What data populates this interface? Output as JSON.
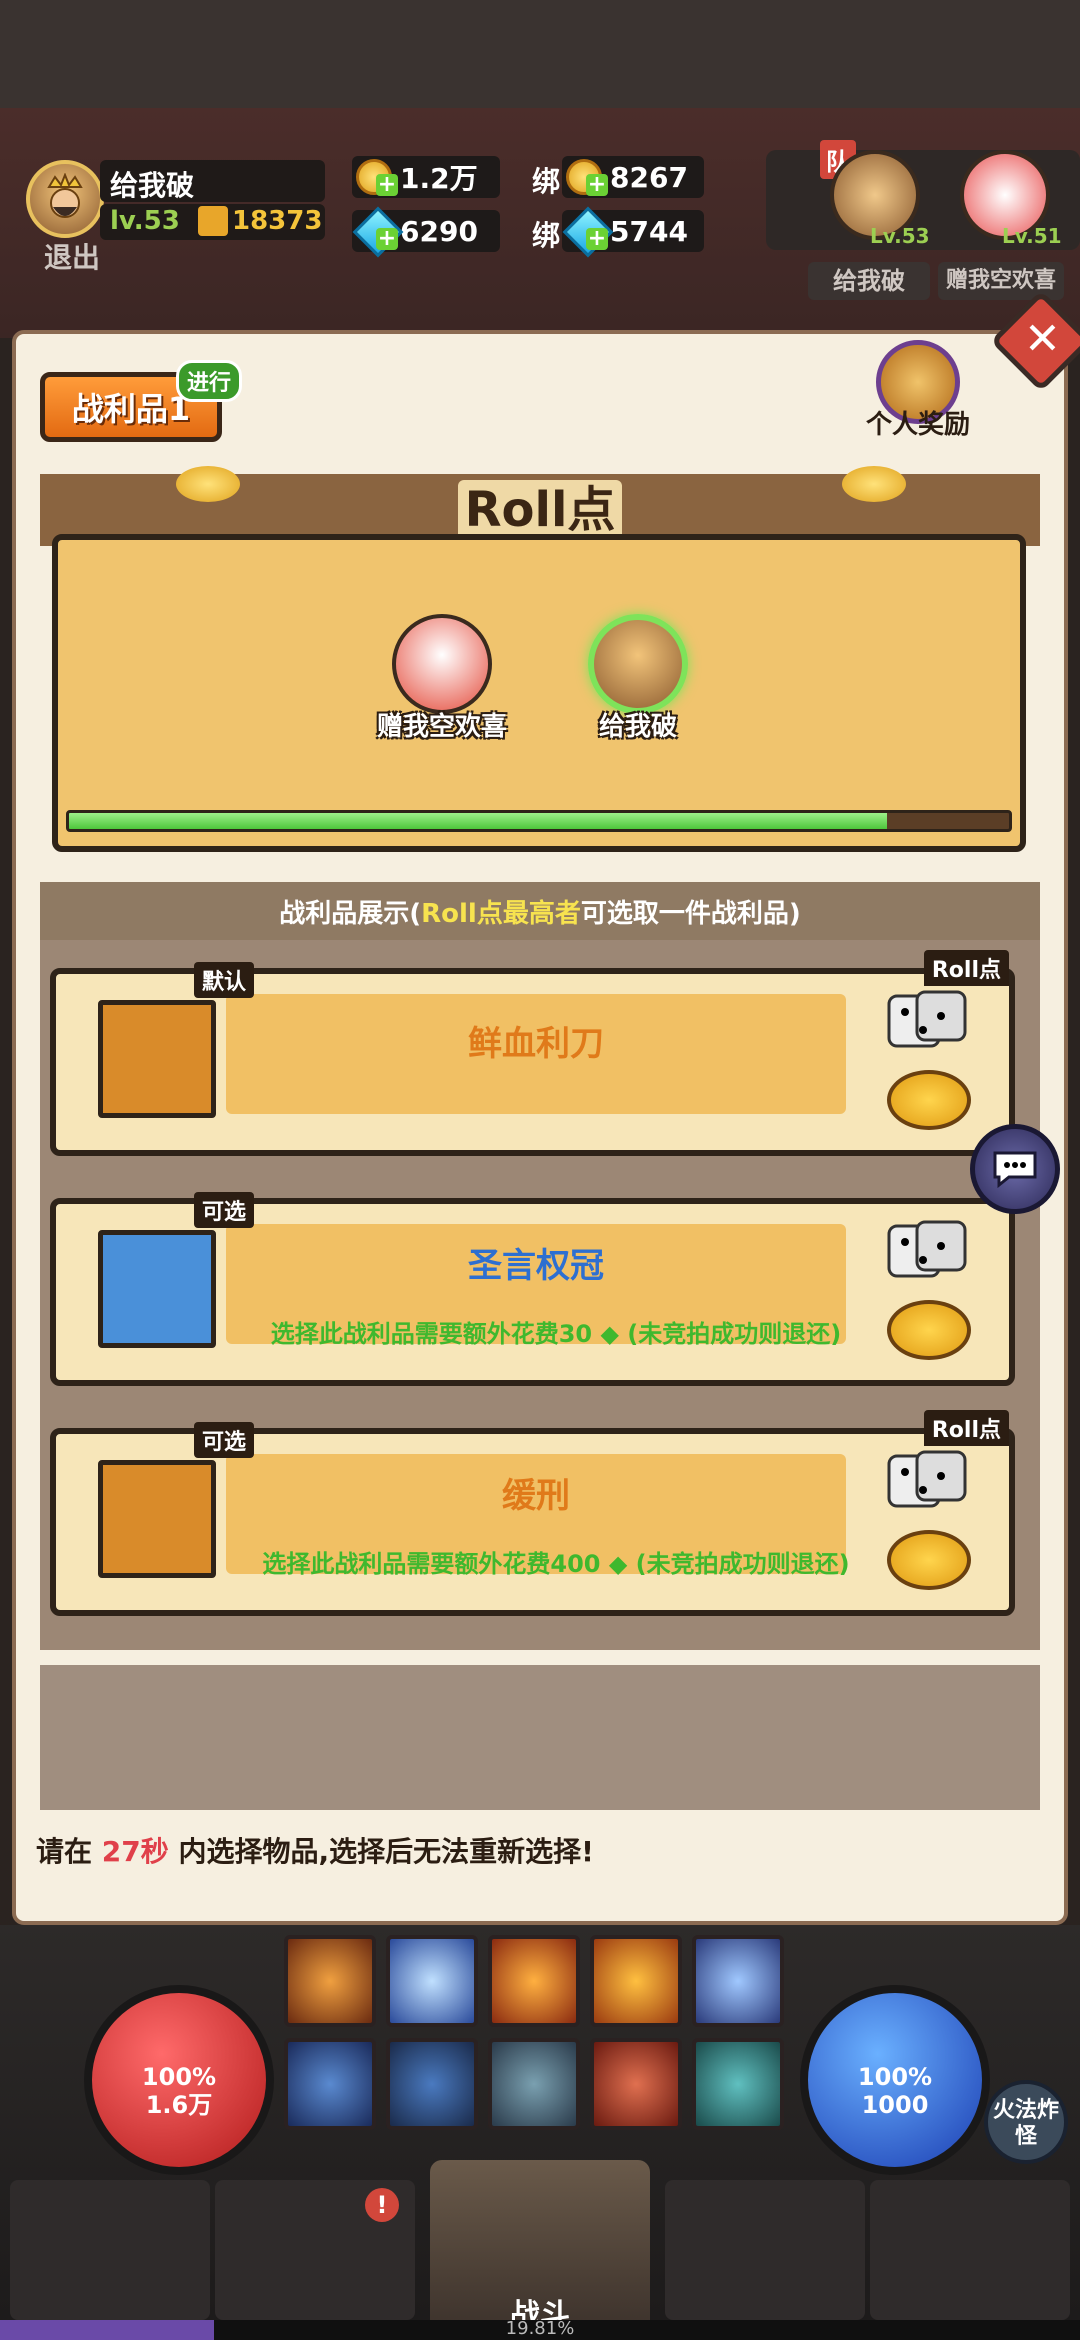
{
  "player": {
    "name": "给我破",
    "level": "lv.53",
    "power": "18373",
    "exit_label": "退出"
  },
  "currency": {
    "gold": "1.2万",
    "bound_gold_prefix": "绑",
    "bound_gold": "8267",
    "gems": "6290",
    "bound_gems_prefix": "绑",
    "bound_gems": "5744"
  },
  "team": {
    "tag": "队",
    "members": [
      {
        "name": "给我破",
        "level": "Lv.53"
      },
      {
        "name": "赠我空欢喜",
        "level": "Lv.51"
      }
    ]
  },
  "panel": {
    "tab_label": "战利品1",
    "tab_status": "进行",
    "personal_reward": "个人奖励",
    "roll_title": "Roll点",
    "roll_progress": 0.87,
    "roll_players": [
      {
        "name": "赠我空欢喜",
        "highlight": false
      },
      {
        "name": "给我破",
        "highlight": true
      }
    ],
    "loot_banner_prefix": "战利品展示(",
    "loot_banner_hl": "Roll点最高者",
    "loot_banner_suffix": "可选取一件战利品)",
    "roll_tag": "Roll点",
    "loot": [
      {
        "tag": "默认",
        "name": "鲜血利刀",
        "name_color": "#e07a1a",
        "note": "",
        "color": "#d98b2a"
      },
      {
        "tag": "可选",
        "name": "圣言权冠",
        "name_color": "#2d6fd1",
        "note": "选择此战利品需要额外花费30 ◆ (未竞拍成功则退还)",
        "color": "#4a90d9"
      },
      {
        "tag": "可选",
        "name": "缓刑",
        "name_color": "#e07a1a",
        "note": "选择此战利品需要额外花费400 ◆ (未竞拍成功则退还)",
        "color": "#d98b2a"
      }
    ],
    "footer_prefix": "请在",
    "footer_seconds": "27秒",
    "footer_suffix": "内选择物品,选择后无法重新选择!"
  },
  "bottom": {
    "hp_percent": "100%",
    "hp_value": "1.6万",
    "mp_percent": "100%",
    "mp_value": "1000",
    "auto_skill": "火法炸怪",
    "battle_label": "战斗",
    "xp_percent": "19.81%",
    "xp_fraction": 0.1981
  }
}
